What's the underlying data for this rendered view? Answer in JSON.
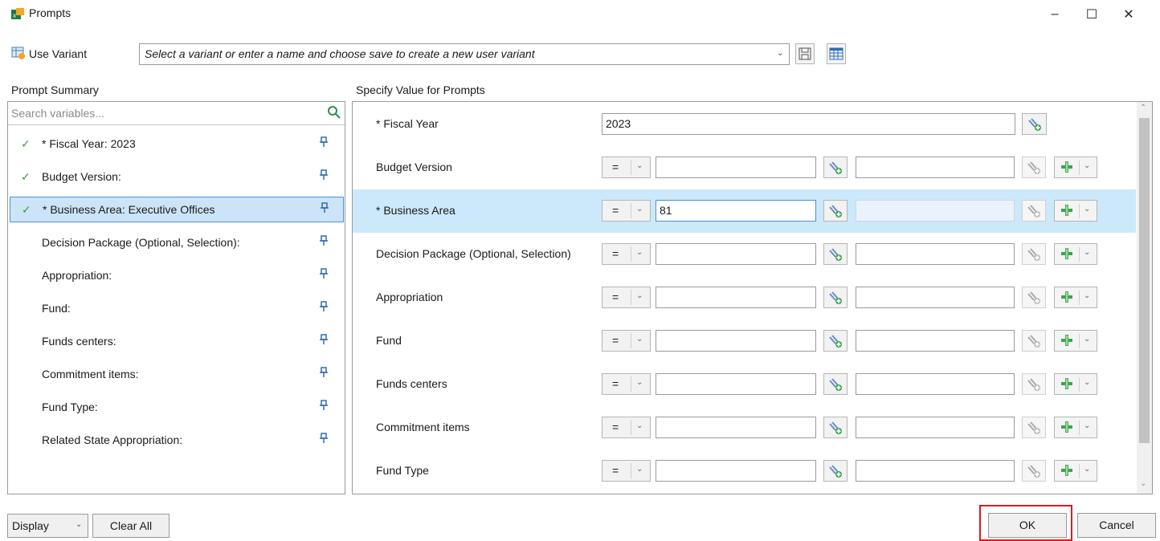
{
  "window": {
    "title": "Prompts",
    "minimize": "–",
    "maximize": "☐",
    "close": "✕"
  },
  "variant": {
    "label": "Use Variant",
    "placeholder": "Select a variant or enter a name and choose save to create a new user variant"
  },
  "prompt_summary": {
    "heading": "Prompt Summary",
    "search_placeholder": "Search variables...",
    "items": [
      {
        "label": "* Fiscal Year: 2023",
        "checked": true,
        "selected": false
      },
      {
        "label": "Budget Version:",
        "checked": true,
        "selected": false
      },
      {
        "label": "* Business Area: Executive Offices",
        "checked": true,
        "selected": true
      },
      {
        "label": "Decision Package (Optional, Selection):",
        "checked": false,
        "selected": false
      },
      {
        "label": "Appropriation:",
        "checked": false,
        "selected": false
      },
      {
        "label": "Fund:",
        "checked": false,
        "selected": false
      },
      {
        "label": "Funds centers:",
        "checked": false,
        "selected": false
      },
      {
        "label": "Commitment items:",
        "checked": false,
        "selected": false
      },
      {
        "label": "Fund Type:",
        "checked": false,
        "selected": false
      },
      {
        "label": "Related State Appropriation:",
        "checked": false,
        "selected": false
      }
    ]
  },
  "specify": {
    "heading": "Specify Value for Prompts",
    "fiscal_year": {
      "label": "* Fiscal Year",
      "value": "2023"
    },
    "rows": [
      {
        "label": "Budget Version",
        "operator": "=",
        "value": "",
        "selected": false
      },
      {
        "label": "* Business Area",
        "operator": "=",
        "value": "81",
        "selected": true
      },
      {
        "label": "Decision Package (Optional, Selection)",
        "operator": "=",
        "value": "",
        "selected": false
      },
      {
        "label": "Appropriation",
        "operator": "=",
        "value": "",
        "selected": false
      },
      {
        "label": "Fund",
        "operator": "=",
        "value": "",
        "selected": false
      },
      {
        "label": "Funds centers",
        "operator": "=",
        "value": "",
        "selected": false
      },
      {
        "label": "Commitment items",
        "operator": "=",
        "value": "",
        "selected": false
      },
      {
        "label": "Fund Type",
        "operator": "=",
        "value": "",
        "selected": false
      }
    ]
  },
  "footer": {
    "display_label": "Display",
    "clear_all_label": "Clear All",
    "ok_label": "OK",
    "cancel_label": "Cancel"
  },
  "colors": {
    "selection": "#cce4f7",
    "highlight_border": "#e0191b",
    "check": "#3a9a3a"
  }
}
